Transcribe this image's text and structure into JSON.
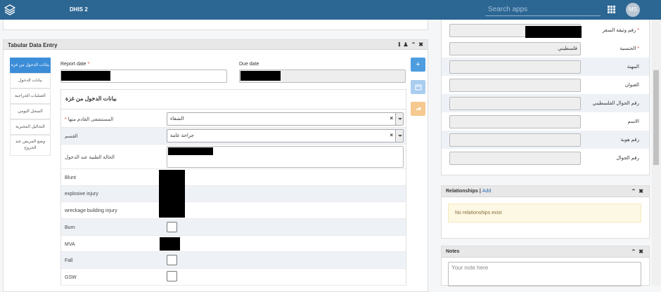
{
  "header": {
    "app_title": "DHIS 2",
    "search_placeholder": "Search apps",
    "avatar_initials": "MS",
    "bg_color": "#2c6693"
  },
  "widget": {
    "title": "Tabular Data Entry",
    "tabs": [
      "بيانات الدخول من غزة",
      "بيانات الدخول",
      "العمليات الجراحية",
      "السجل اليومي",
      "التحاليل المخبرية",
      "وضع المريض عند الخروج"
    ],
    "report_date_label": "Report date",
    "due_date_label": "Due date",
    "form_title": "بيانات الدخول من غزة",
    "rows": {
      "hospital_label": "المستشفى القادم منها",
      "hospital_value": "الشفاء",
      "section_label": "القسم",
      "section_value": "جراحة عامة",
      "condition_label": "الحالة الطبية عند الدخول",
      "blunt": "Blunt",
      "explosive": "explosive injury",
      "wreckage": "wreckage building injury",
      "burn": "Burn",
      "mva": "MVA",
      "fall": "Fall",
      "gsw": "GSW"
    },
    "side_buttons": [
      "+",
      "calendar",
      "share"
    ]
  },
  "profile": {
    "fields": [
      {
        "label": "رقم وثيقة السفر",
        "required": true,
        "value": ""
      },
      {
        "label": "الجنسية",
        "required": true,
        "value": "فلسطيني"
      },
      {
        "label": "المهنة",
        "required": false,
        "value": ""
      },
      {
        "label": "العنوان",
        "required": false,
        "value": ""
      },
      {
        "label": "رقم الجوال الفلسطيني",
        "required": false,
        "value": ""
      },
      {
        "label": "الاسم",
        "required": false,
        "value": ""
      },
      {
        "label": "رقم هوية",
        "required": false,
        "value": ""
      },
      {
        "label": "رقم الجوال",
        "required": false,
        "value": ""
      }
    ]
  },
  "relationships": {
    "title": "Relationships",
    "add_link": "Add",
    "empty_text": "No relationships exist"
  },
  "notes": {
    "title": "Notes",
    "placeholder": "Your note here"
  }
}
